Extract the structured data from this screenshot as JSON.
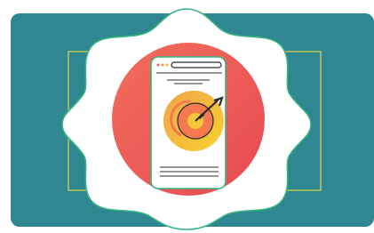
{
  "illustration": {
    "icons": {
      "window_dots": "window-dots-icon",
      "target": "target-icon",
      "arrow": "arrow-icon"
    },
    "colors": {
      "panel": "#2E8791",
      "highlight_frame": "#E6D64D",
      "blob_fill": "#FFFFFF",
      "blob_stroke": "#35B57E",
      "circle_start": "#F26E5A",
      "circle_end": "#E64A55",
      "page_fill": "#FFFFFF",
      "page_stroke": "#35B57E",
      "bar_stroke": "#2B2B2B",
      "dot_red": "#F05A6A",
      "dot_yellow": "#F6B62A",
      "dot_orange": "#F28A4A",
      "target_outer_start": "#F2A24B",
      "target_outer_end": "#F6D330",
      "target_inner": "#F27A4E",
      "target_ring": "#2B2B2B",
      "arrow": "#2B2B2B",
      "lines": "#2B2B2B"
    }
  }
}
